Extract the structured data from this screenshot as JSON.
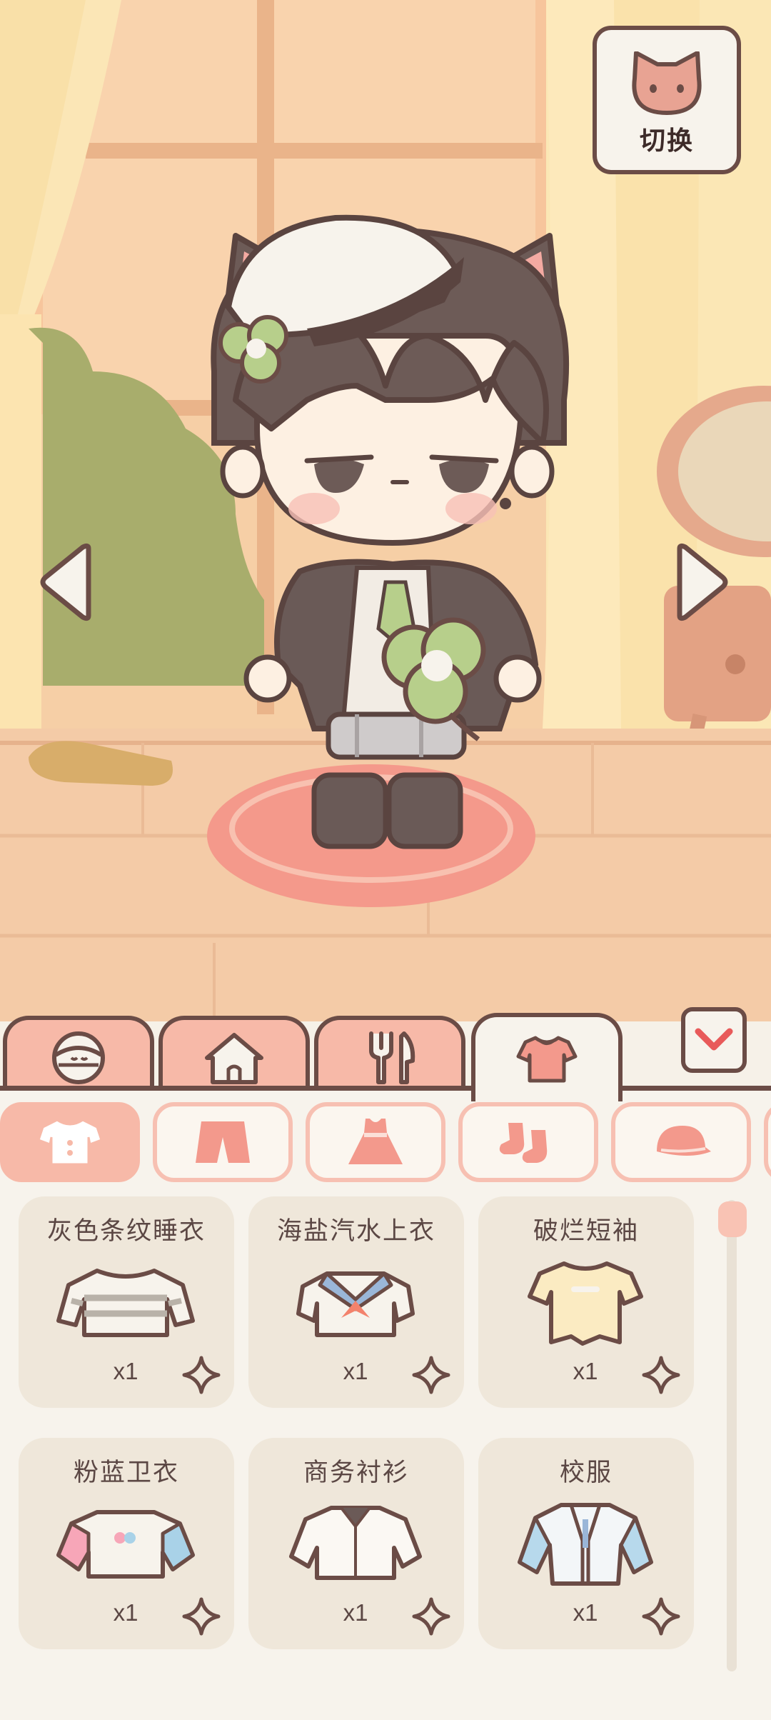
{
  "switch_button": {
    "label": "切换",
    "icon": "cat-face-icon"
  },
  "nav": {
    "prev_icon": "arrow-left-icon",
    "next_icon": "arrow-right-icon"
  },
  "category_tabs": [
    {
      "icon": "face-icon",
      "active": false
    },
    {
      "icon": "house-icon",
      "active": false
    },
    {
      "icon": "fork-knife-icon",
      "active": false
    },
    {
      "icon": "shirt-icon",
      "active": true
    }
  ],
  "collapse_icon": "chevron-down-icon",
  "sub_tabs": [
    {
      "icon": "top-icon",
      "active": true
    },
    {
      "icon": "shorts-icon",
      "active": false
    },
    {
      "icon": "dress-icon",
      "active": false
    },
    {
      "icon": "socks-icon",
      "active": false
    },
    {
      "icon": "cap-icon",
      "active": false
    }
  ],
  "items": [
    {
      "name": "灰色条纹睡衣",
      "qty": "x1"
    },
    {
      "name": "海盐汽水上衣",
      "qty": "x1"
    },
    {
      "name": "破烂短袖",
      "qty": "x1"
    },
    {
      "name": "粉蓝卫衣",
      "qty": "x1"
    },
    {
      "name": "商务衬衫",
      "qty": "x1"
    },
    {
      "name": "校服",
      "qty": "x1"
    }
  ],
  "colors": {
    "outline": "#6b4c46",
    "pink_tab": "#f7b9a8",
    "cream": "#f7f3ec",
    "card": "#efe7da"
  }
}
